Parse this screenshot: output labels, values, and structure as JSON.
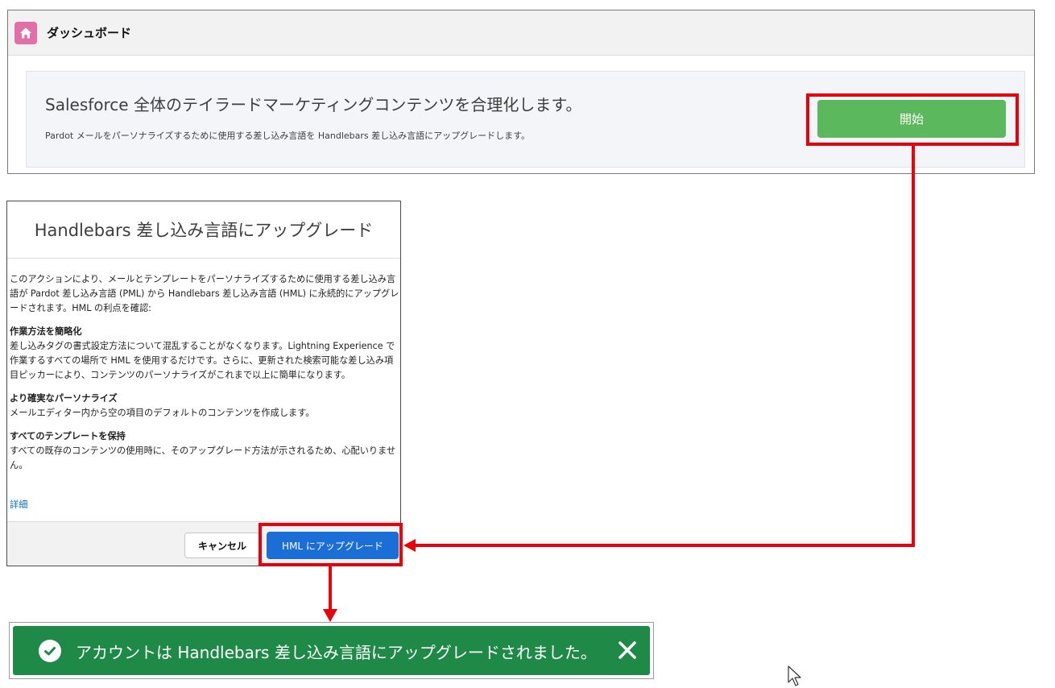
{
  "dashboard": {
    "title": "ダッシュボード",
    "icon": "home-icon",
    "banner_title": "Salesforce 全体のテイラードマーケティングコンテンツを合理化します。",
    "banner_subtitle": "Pardot メールをパーソナライズするために使用する差し込み言語を Handlebars 差し込み言語にアップグレードします。",
    "start_button": "開始"
  },
  "modal": {
    "title": "Handlebars 差し込み言語にアップグレード",
    "intro": "このアクションにより、メールとテンプレートをパーソナライズするために使用する差し込み言語が Pardot 差し込み言語 (PML) から Handlebars 差し込み言語 (HML) に永続的にアップグレードされます。HML の利点を確認:",
    "sections": [
      {
        "title": "作業方法を簡略化",
        "text": "差し込みタグの書式設定方法について混乱することがなくなります。Lightning Experience で作業するすべての場所で HML を使用するだけです。さらに、更新された検索可能な差し込み項目ピッカーにより、コンテンツのパーソナライズがこれまで以上に簡単になります。"
      },
      {
        "title": "より確実なパーソナライズ",
        "text": "メールエディター内から空の項目のデフォルトのコンテンツを作成します。"
      },
      {
        "title": "すべてのテンプレートを保持",
        "text": "すべての既存のコンテンツの使用時に、そのアップグレード方法が示されるため、心配いりません。"
      }
    ],
    "more_link": "詳細",
    "cancel_button": "キャンセル",
    "upgrade_button": "HML にアップグレード"
  },
  "toast": {
    "message": "アカウントは Handlebars 差し込み言語にアップグレードされました。",
    "icon": "success-check-icon",
    "close_icon": "close-icon"
  },
  "colors": {
    "home_icon_bg": "#e26fa8",
    "start_button": "#5cb85c",
    "upgrade_button": "#1b6ed6",
    "toast_bg": "#1f8a48",
    "annotation": "#e8000b"
  }
}
